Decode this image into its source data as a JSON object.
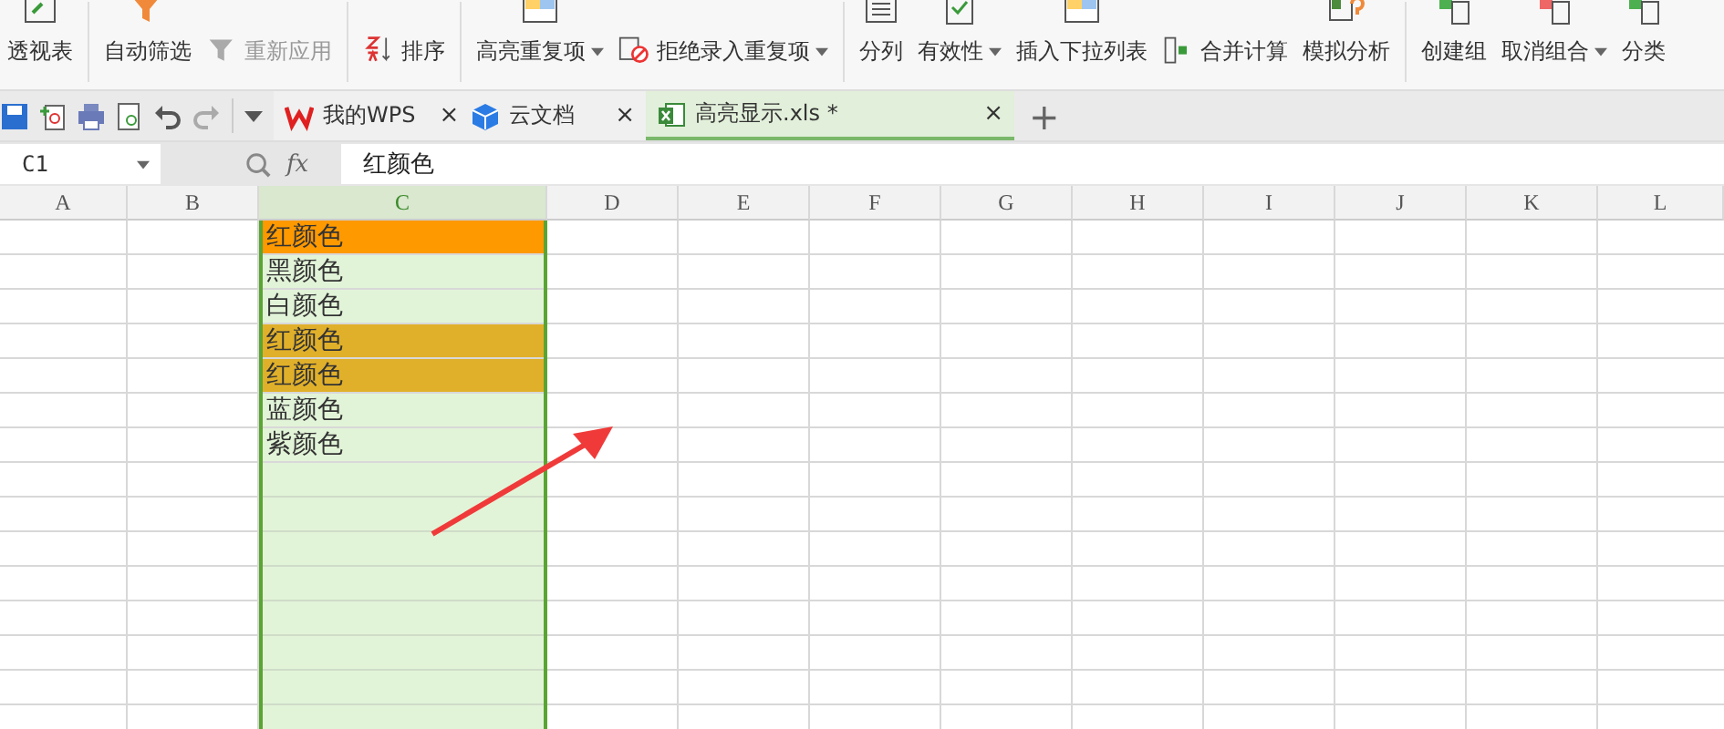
{
  "ribbon": [
    {
      "label": "透视表",
      "kind": "large",
      "dropdown": false,
      "disabled": false
    },
    {
      "label": "自动筛选",
      "kind": "large",
      "dropdown": false,
      "disabled": false
    },
    {
      "label": "重新应用",
      "kind": "small",
      "dropdown": false,
      "disabled": true
    },
    {
      "label": "排序",
      "kind": "small",
      "dropdown": false,
      "disabled": false
    },
    {
      "label": "高亮重复项",
      "kind": "large",
      "dropdown": true,
      "disabled": false
    },
    {
      "label": "拒绝录入重复项",
      "kind": "small",
      "dropdown": true,
      "disabled": false
    },
    {
      "label": "分列",
      "kind": "large",
      "dropdown": false,
      "disabled": false
    },
    {
      "label": "有效性",
      "kind": "large",
      "dropdown": true,
      "disabled": false
    },
    {
      "label": "插入下拉列表",
      "kind": "large",
      "dropdown": false,
      "disabled": false
    },
    {
      "label": "合并计算",
      "kind": "small",
      "dropdown": false,
      "disabled": false
    },
    {
      "label": "模拟分析",
      "kind": "large",
      "dropdown": false,
      "disabled": false
    },
    {
      "label": "创建组",
      "kind": "large",
      "dropdown": false,
      "disabled": false
    },
    {
      "label": "取消组合",
      "kind": "large",
      "dropdown": true,
      "disabled": false
    },
    {
      "label": "分类",
      "kind": "large",
      "dropdown": false,
      "disabled": false
    }
  ],
  "tabs": [
    {
      "title": "我的WPS",
      "kind": "wps",
      "selected": false,
      "close": "×"
    },
    {
      "title": "云文档",
      "kind": "cloud",
      "selected": false,
      "close": "×"
    },
    {
      "title": "高亮显示.xls *",
      "kind": "sheet",
      "selected": true,
      "close": "×"
    }
  ],
  "new_tab": "+",
  "formula_bar": {
    "name_box": "C1",
    "fx": "fx",
    "value": "红颜色"
  },
  "columns": [
    {
      "letter": "A",
      "selected": false
    },
    {
      "letter": "B",
      "selected": false
    },
    {
      "letter": "C",
      "selected": true
    },
    {
      "letter": "D",
      "selected": false
    },
    {
      "letter": "E",
      "selected": false
    },
    {
      "letter": "F",
      "selected": false
    },
    {
      "letter": "G",
      "selected": false
    },
    {
      "letter": "H",
      "selected": false
    },
    {
      "letter": "I",
      "selected": false
    },
    {
      "letter": "J",
      "selected": false
    },
    {
      "letter": "K",
      "selected": false
    },
    {
      "letter": "L",
      "selected": false
    }
  ],
  "column_c_cells": [
    {
      "text": "红颜色",
      "color": "#ff9900"
    },
    {
      "text": "黑颜色",
      "color": "#e2f4d8"
    },
    {
      "text": "白颜色",
      "color": "#e2f4d8"
    },
    {
      "text": "红颜色",
      "color": "#e1b02a"
    },
    {
      "text": "红颜色",
      "color": "#e1b02a"
    },
    {
      "text": "蓝颜色",
      "color": "#e2f4d8"
    },
    {
      "text": "紫颜色",
      "color": "#e2f4d8"
    }
  ]
}
